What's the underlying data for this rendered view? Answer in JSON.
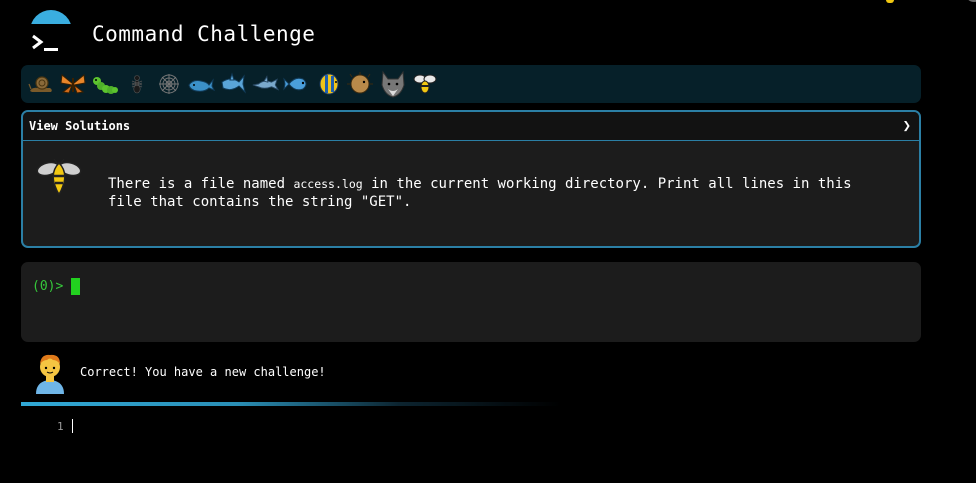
{
  "header": {
    "title": "Command Challenge",
    "logo_icon": "terminal-prompt-icon",
    "accent_color": "#3aaee0"
  },
  "critters": [
    {
      "name": "snail-icon"
    },
    {
      "name": "butterfly-icon"
    },
    {
      "name": "caterpillar-icon"
    },
    {
      "name": "ant-icon"
    },
    {
      "name": "spider-web-icon"
    },
    {
      "name": "whale-icon"
    },
    {
      "name": "shark-icon"
    },
    {
      "name": "dolphin-icon"
    },
    {
      "name": "fish-icon"
    },
    {
      "name": "tropical-fish-icon"
    },
    {
      "name": "blowfish-icon"
    },
    {
      "name": "wolf-icon"
    },
    {
      "name": "bee-icon"
    }
  ],
  "challenge": {
    "header_label": "View Solutions",
    "chevron": "❯",
    "avatar_icon": "bee-icon",
    "text_before": "There is a file named ",
    "code": "access.log",
    "text_after": " in the current working directory. Print all lines in this file that contains the string \"GET\"."
  },
  "terminal": {
    "prompt": "(0)>",
    "prompt_color": "#35c83a"
  },
  "feedback": {
    "avatar_icon": "person-icon",
    "message": "Correct! You have a new challenge!",
    "progress": 1.0
  },
  "editor": {
    "line_number": "1"
  }
}
